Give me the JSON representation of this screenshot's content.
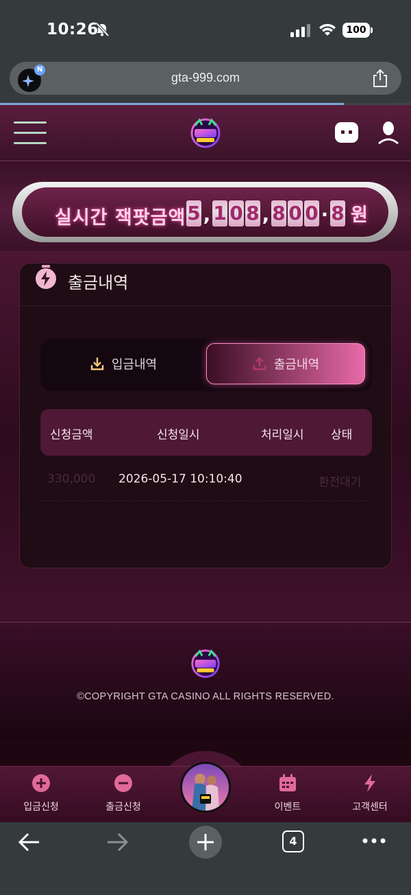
{
  "status_bar": {
    "time": "10:26",
    "battery": "100"
  },
  "browser": {
    "url": "gta-999.com",
    "site_badge": "N",
    "tab_count": "4"
  },
  "jackpot": {
    "label": "실시간 잭팟금액",
    "digits": [
      "5",
      ",",
      "1",
      "0",
      "8",
      ",",
      "8",
      "0",
      "0",
      "·",
      "8"
    ],
    "unit": "원"
  },
  "panel": {
    "title": "출금내역"
  },
  "tabs": {
    "deposit": "입금내역",
    "withdraw": "출금내역"
  },
  "table": {
    "headers": {
      "amount": "신청금액",
      "requested": "신청일시",
      "processed": "처리일시",
      "status": "상태"
    },
    "rows": [
      {
        "amount": "330,000",
        "requested": "2026-05-17 10:10:40",
        "processed": "",
        "status": "환전대기"
      }
    ]
  },
  "footer": {
    "copyright": "©COPYRIGHT GTA CASINO ALL RIGHTS RESERVED."
  },
  "bottom_nav": {
    "deposit": "입금신청",
    "withdraw": "출금신청",
    "events": "이벤트",
    "support": "고객센터"
  },
  "colors": {
    "accent": "#e86aa8",
    "header": "#5a1d3e",
    "panel": "#1f0c15"
  }
}
